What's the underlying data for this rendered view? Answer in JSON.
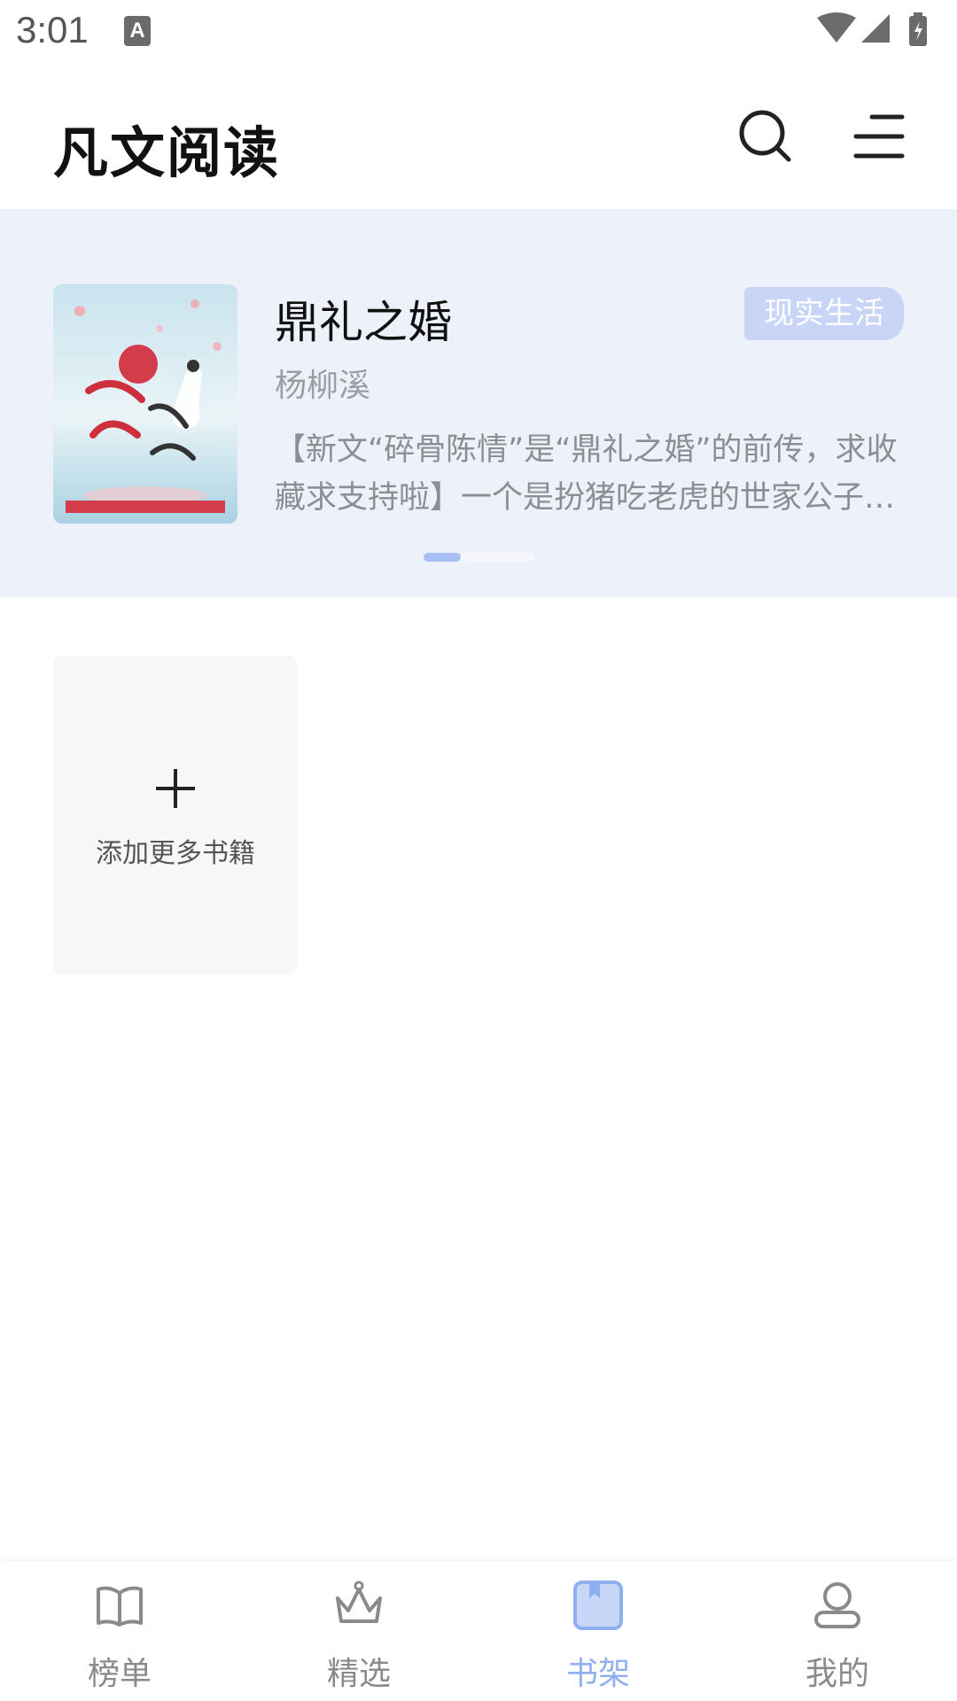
{
  "status_bar": {
    "time": "3:01",
    "notification_icon": "A"
  },
  "header": {
    "app_title": "凡文阅读",
    "search_icon": "search-icon",
    "menu_icon": "menu-icon"
  },
  "banner": {
    "book_title": "鼎礼之婚",
    "author": "杨柳溪",
    "genre_tag": "现实生活",
    "description": "【新文“碎骨陈情”是“鼎礼之婚”的前传，求收藏求支持啦】一个是扮猪吃老虎的世家公子，一个是...",
    "page_indicator": {
      "current": 1,
      "total": 2
    }
  },
  "shelf": {
    "add_book_label": "添加更多书籍"
  },
  "bottom_nav": {
    "items": [
      {
        "label": "榜单",
        "icon": "book-open-icon",
        "active": false
      },
      {
        "label": "精选",
        "icon": "crown-icon",
        "active": false
      },
      {
        "label": "书架",
        "icon": "bookshelf-icon",
        "active": true
      },
      {
        "label": "我的",
        "icon": "user-icon",
        "active": false
      }
    ]
  },
  "colors": {
    "accent": "#8fb0f0",
    "banner_bg": "#edf1fa",
    "tag_bg": "#c8d5f6"
  }
}
